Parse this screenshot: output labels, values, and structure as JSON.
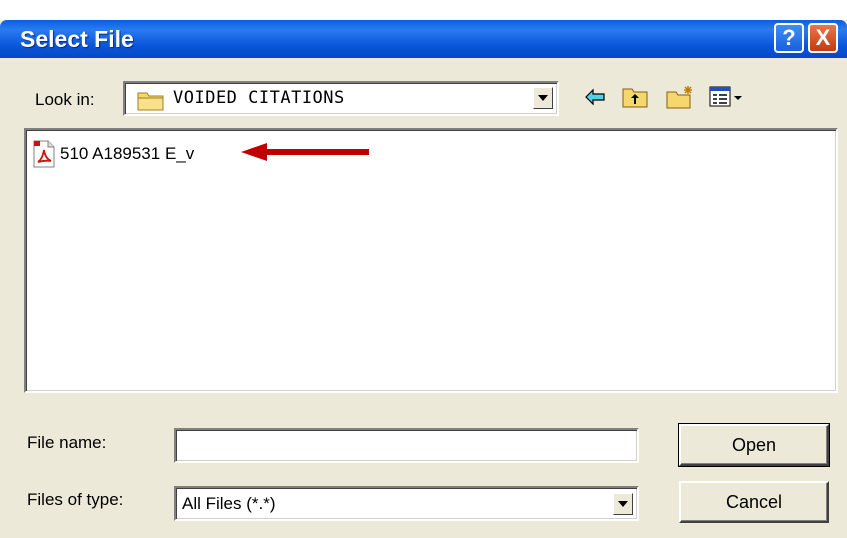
{
  "window": {
    "title": "Select File",
    "help_label": "?",
    "close_label": "X"
  },
  "toolbar": {
    "look_in_label": "Look in:",
    "look_in_value": "VOIDED CITATIONS",
    "icons": [
      "back-arrow-icon",
      "up-folder-icon",
      "new-folder-icon",
      "view-menu-icon"
    ]
  },
  "file_list": {
    "items": [
      {
        "name": "510 A189531 E_v",
        "icon": "pdf-file-icon"
      }
    ],
    "annotation": "red-arrow-icon"
  },
  "form": {
    "file_name_label": "File name:",
    "file_name_value": "",
    "files_of_type_label": "Files of type:",
    "files_of_type_value": "All Files (*.*)"
  },
  "buttons": {
    "open_label": "Open",
    "cancel_label": "Cancel"
  },
  "colors": {
    "titlebar": "#0a5fe0",
    "dialog_bg": "#ece9d8",
    "arrow": "#c00000"
  }
}
